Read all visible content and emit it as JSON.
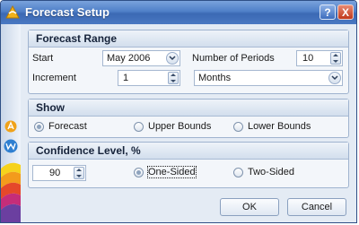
{
  "window": {
    "title": "Forecast Setup",
    "help_label": "?",
    "close_label": "X"
  },
  "forecast_range": {
    "header": "Forecast Range",
    "start_label": "Start",
    "start_value": "May 2006",
    "periods_label": "Number of Periods",
    "periods_value": "10",
    "increment_label": "Increment",
    "increment_value": "1",
    "unit_value": "Months"
  },
  "show": {
    "header": "Show",
    "options": [
      {
        "label": "Forecast",
        "selected": true
      },
      {
        "label": "Upper Bounds",
        "selected": false
      },
      {
        "label": "Lower Bounds",
        "selected": false
      }
    ]
  },
  "confidence": {
    "header": "Confidence Level, %",
    "value": "90",
    "options": [
      {
        "label": "One-Sided",
        "selected": true
      },
      {
        "label": "Two-Sided",
        "selected": false
      }
    ]
  },
  "buttons": {
    "ok": "OK",
    "cancel": "Cancel"
  },
  "colors": {
    "title_bar": "#4f7fc8",
    "close_button": "#c0391b",
    "group_border": "#9fb3cf"
  }
}
